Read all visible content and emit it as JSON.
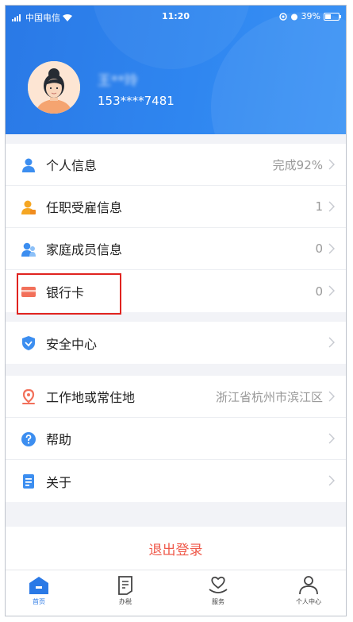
{
  "status_bar": {
    "carrier": "中国电信",
    "time": "11:20",
    "battery": "39%"
  },
  "profile": {
    "name": "王**玲",
    "phone": "153****7481"
  },
  "personal_group": [
    {
      "label": "个人信息",
      "value": "完成92%"
    },
    {
      "label": "任职受雇信息",
      "value": "1"
    },
    {
      "label": "家庭成员信息",
      "value": "0"
    },
    {
      "label": "银行卡",
      "value": "0"
    }
  ],
  "security_group": [
    {
      "label": "安全中心",
      "value": ""
    }
  ],
  "other_group": [
    {
      "label": "工作地或常住地",
      "value": "浙江省杭州市滨江区"
    },
    {
      "label": "帮助",
      "value": ""
    },
    {
      "label": "关于",
      "value": ""
    }
  ],
  "logout_label": "退出登录",
  "tabs": [
    {
      "label": "首页",
      "icon": "home-icon",
      "active": true
    },
    {
      "label": "办税",
      "icon": "document-icon",
      "active": false
    },
    {
      "label": "服务",
      "icon": "heart-hand-icon",
      "active": false
    },
    {
      "label": "个人中心",
      "icon": "person-icon",
      "active": false
    }
  ],
  "colors": {
    "header_blue": "#2a79e6",
    "logout_red": "#ef5a4b",
    "highlight_red": "#e0231f"
  }
}
